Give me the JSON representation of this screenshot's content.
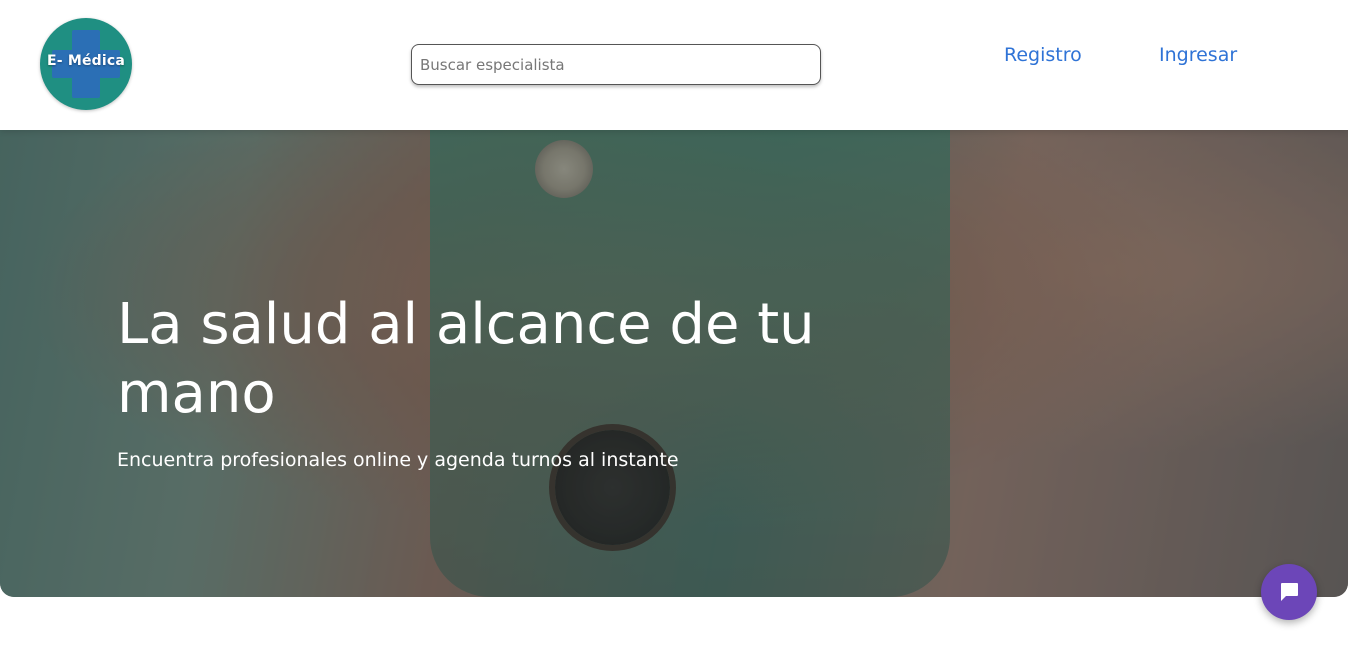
{
  "header": {
    "logo": {
      "text": "E- Médica",
      "colors": {
        "circle": "#1f8f82",
        "cross": "#2b6fb5"
      }
    },
    "search": {
      "placeholder": "Buscar especialista",
      "value": ""
    },
    "nav": {
      "registro_label": "Registro",
      "ingresar_label": "Ingresar"
    }
  },
  "hero": {
    "title": "La salud al alcance de tu mano",
    "subtitle": "Encuentra profesionales online y agenda turnos al instante",
    "image_icon": "doctor-arms-crossed-image"
  },
  "chat": {
    "icon": "chat-bubble-icon"
  },
  "colors": {
    "link": "#2f73d6",
    "chat_button": "#6c46b8",
    "hero_text": "#ffffff"
  }
}
